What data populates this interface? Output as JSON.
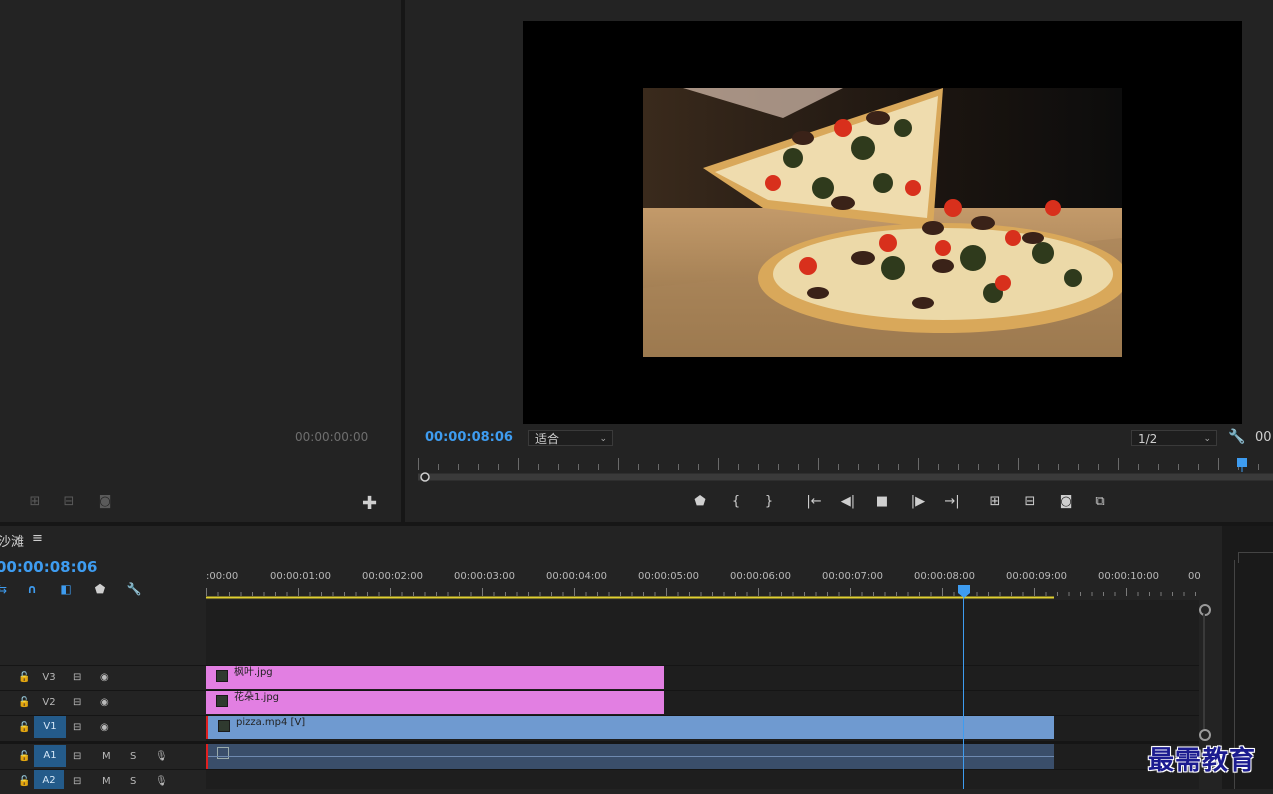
{
  "source": {
    "timecode": "00:00:00:00",
    "buttons": [
      {
        "name": "insert-icon",
        "glyph": "⊞"
      },
      {
        "name": "overwrite-icon",
        "glyph": "⊟"
      },
      {
        "name": "camera-icon",
        "glyph": "◙"
      }
    ],
    "add_glyph": "✚"
  },
  "program": {
    "timecode": "00:00:08:06",
    "fit_label": "适合",
    "resolution": "1/2",
    "duration_partial": "00",
    "controls": [
      {
        "name": "add-marker-icon",
        "glyph": "⬟"
      },
      {
        "name": "mark-in-icon",
        "glyph": "{"
      },
      {
        "name": "mark-out-icon",
        "glyph": "}"
      },
      {
        "name": "go-to-in-icon",
        "glyph": "|←"
      },
      {
        "name": "step-back-icon",
        "glyph": "◀|"
      },
      {
        "name": "stop-icon",
        "glyph": "■"
      },
      {
        "name": "step-forward-icon",
        "glyph": "|▶"
      },
      {
        "name": "go-to-out-icon",
        "glyph": "→|"
      },
      {
        "name": "lift-icon",
        "glyph": "⊞"
      },
      {
        "name": "extract-icon",
        "glyph": "⊟"
      },
      {
        "name": "export-frame-icon",
        "glyph": "◙"
      },
      {
        "name": "compare-view-icon",
        "glyph": "⧉"
      }
    ]
  },
  "timeline": {
    "sequence_name": "沙滩",
    "menu_glyph": "≡",
    "timecode": "00:00:08:06",
    "ruler": [
      ":00:00",
      "00:00:01:00",
      "00:00:02:00",
      "00:00:03:00",
      "00:00:04:00",
      "00:00:05:00",
      "00:00:06:00",
      "00:00:07:00",
      "00:00:08:00",
      "00:00:09:00",
      "00:00:10:00",
      "00"
    ],
    "tracks": [
      {
        "id": "V3",
        "type": "video",
        "clip": "枫叶.jpg"
      },
      {
        "id": "V2",
        "type": "video",
        "clip": "花朵1.jpg"
      },
      {
        "id": "V1",
        "type": "video",
        "clip": "pizza.mp4 [V]"
      },
      {
        "id": "A1",
        "type": "audio",
        "clip": ""
      },
      {
        "id": "A2",
        "type": "audio",
        "clip": ""
      }
    ],
    "audio_m": "M",
    "audio_s": "S"
  },
  "watermark": "最需教育",
  "colors": {
    "accent": "#3e9cf0",
    "image_clip": "#e27fe2",
    "video_clip": "#6f9ad0",
    "audio_clip": "#3a4e6a"
  }
}
